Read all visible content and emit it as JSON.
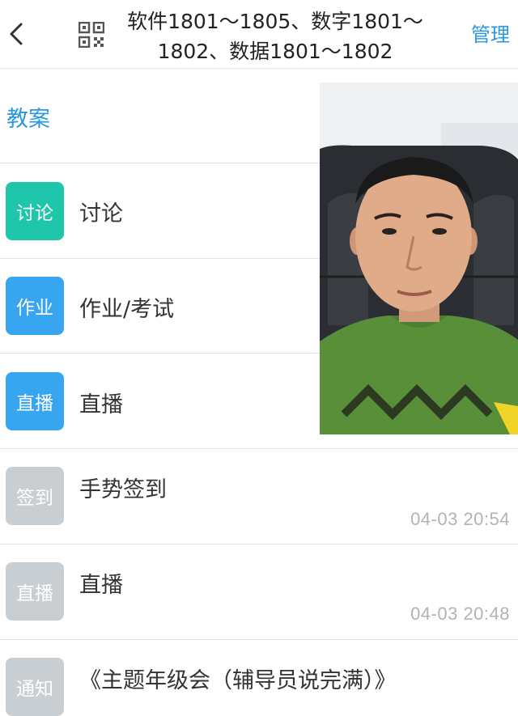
{
  "header": {
    "title_line1": "软件1801～1805、数字1801～",
    "title_line2": "1802、数据1801～1802",
    "manage_label": "管理"
  },
  "rows": [
    {
      "label": "教案"
    },
    {
      "badge": "讨论",
      "label": "讨论"
    },
    {
      "badge": "作业",
      "label": "作业/考试"
    },
    {
      "badge": "直播",
      "label": "直播"
    },
    {
      "badge": "签到",
      "label": "手势签到",
      "time": "04-03 20:54"
    },
    {
      "badge": "直播",
      "label": "直播",
      "time": "04-03 20:48"
    },
    {
      "badge": "通知",
      "label": "《主题年级会（辅导员说完满）》"
    }
  ],
  "colors": {
    "accent": "#2a98e0",
    "badge_teal": "#1ec6aa",
    "badge_blue": "#37a5f0",
    "badge_gray": "#c9ced3",
    "time_gray": "#b3b3b3"
  },
  "icons": [
    "back-arrow-icon",
    "qr-code-icon"
  ],
  "video_overlay": {
    "content": "person-selfie-video"
  }
}
